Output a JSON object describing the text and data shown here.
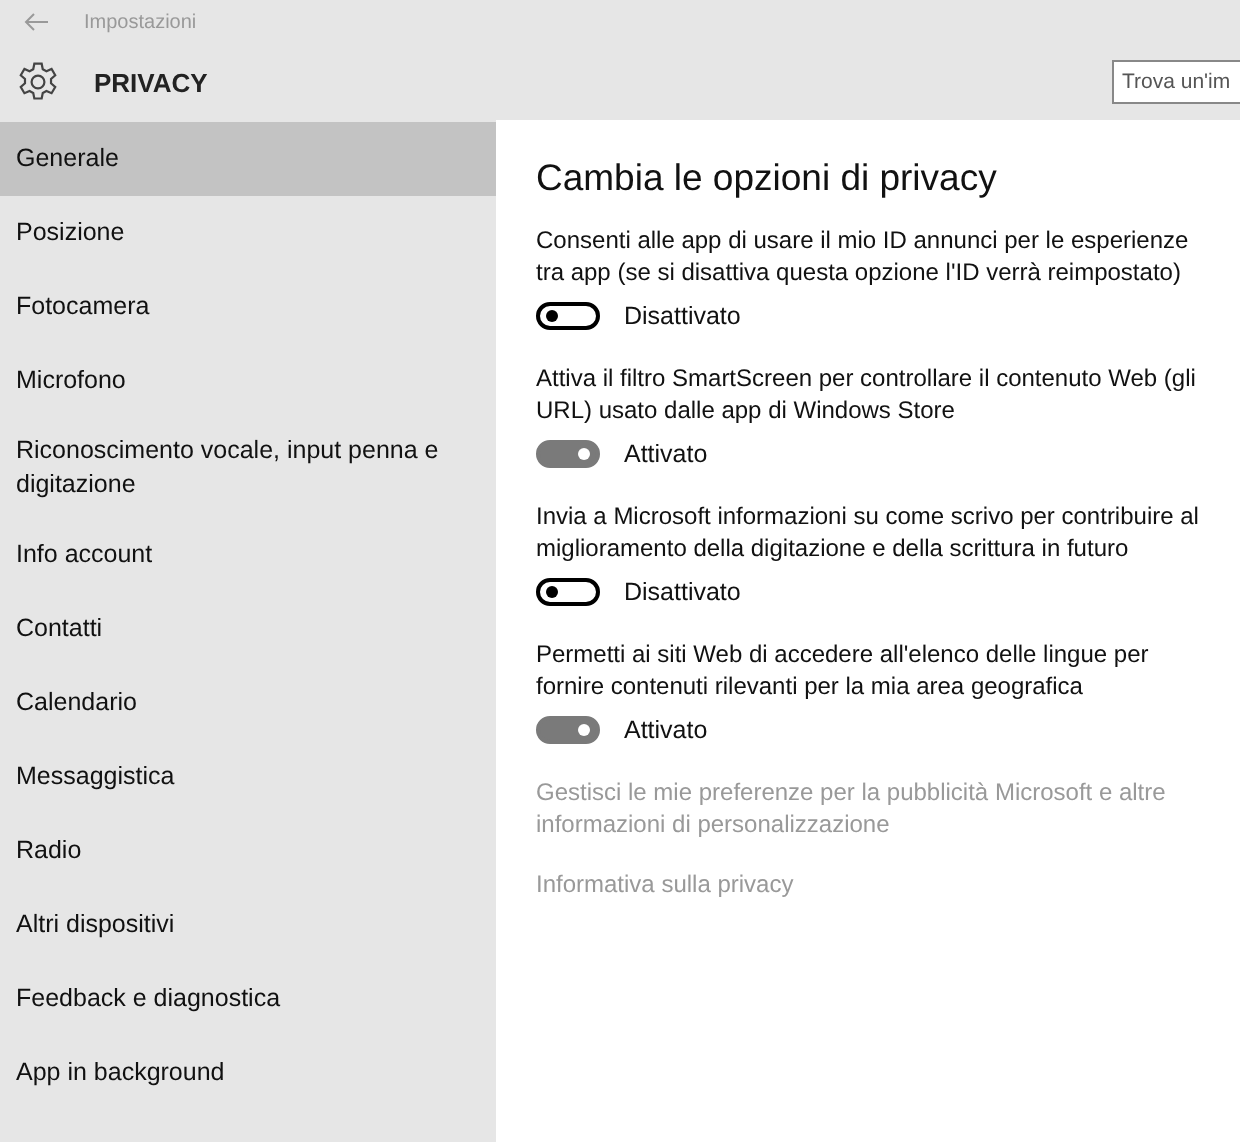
{
  "window": {
    "title": "Impostazioni"
  },
  "header": {
    "title": "PRIVACY",
    "search": {
      "placeholder": "Trova un'im"
    }
  },
  "sidebar": {
    "items": [
      {
        "label": "Generale",
        "selected": true
      },
      {
        "label": "Posizione",
        "selected": false
      },
      {
        "label": "Fotocamera",
        "selected": false
      },
      {
        "label": "Microfono",
        "selected": false
      },
      {
        "label": "Riconoscimento vocale, input penna e digitazione",
        "selected": false
      },
      {
        "label": "Info account",
        "selected": false
      },
      {
        "label": "Contatti",
        "selected": false
      },
      {
        "label": "Calendario",
        "selected": false
      },
      {
        "label": "Messaggistica",
        "selected": false
      },
      {
        "label": "Radio",
        "selected": false
      },
      {
        "label": "Altri dispositivi",
        "selected": false
      },
      {
        "label": "Feedback e diagnostica",
        "selected": false
      },
      {
        "label": "App in background",
        "selected": false
      }
    ]
  },
  "content": {
    "heading": "Cambia le opzioni di privacy",
    "settings": [
      {
        "description": "Consenti alle app di usare il mio ID annunci per le esperienze tra app (se si disattiva questa opzione l'ID verrà reimpostato)",
        "on": false,
        "state_label": "Disattivato"
      },
      {
        "description": "Attiva il filtro SmartScreen per controllare il contenuto Web (gli URL) usato dalle app di Windows Store",
        "on": true,
        "state_label": "Attivato"
      },
      {
        "description": "Invia a Microsoft informazioni su come scrivo per contribuire al miglioramento della digitazione e della scrittura in futuro",
        "on": false,
        "state_label": "Disattivato"
      },
      {
        "description": "Permetti ai siti Web di accedere all'elenco delle lingue per fornire contenuti rilevanti per la mia area geografica",
        "on": true,
        "state_label": "Attivato"
      }
    ],
    "links": [
      "Gestisci le mie preferenze per la pubblicità Microsoft e altre informazioni di personalizzazione",
      "Informativa sulla privacy"
    ]
  }
}
